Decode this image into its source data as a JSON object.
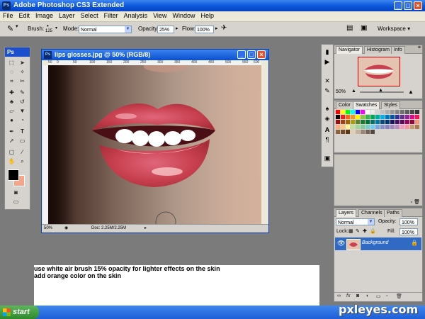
{
  "app": {
    "title": "Adobe Photoshop CS3 Extended",
    "logo": "Ps"
  },
  "menu": [
    "File",
    "Edit",
    "Image",
    "Layer",
    "Select",
    "Filter",
    "Analysis",
    "View",
    "Window",
    "Help"
  ],
  "options": {
    "brush_label": "Brush:",
    "brush_size": "125",
    "mode_label": "Mode:",
    "mode_value": "Normal",
    "opacity_label": "Opacity:",
    "opacity_value": "25%",
    "flow_label": "Flow:",
    "flow_value": "100%",
    "workspace_label": "Workspace ▾"
  },
  "toolbox": {
    "logo": "Ps"
  },
  "document": {
    "title": "lips glosses.jpg @ 50% (RGB/8)",
    "ruler_marks": [
      "50",
      "0",
      "50",
      "100",
      "150",
      "200",
      "250",
      "300",
      "350",
      "400",
      "450",
      "500",
      "550",
      "600"
    ],
    "zoom": "50%",
    "doc_info": "Doc: 2.25M/2.25M"
  },
  "navigator": {
    "tabs": [
      "Navigator",
      "Histogram",
      "Info"
    ],
    "zoom": "50%"
  },
  "color_panel": {
    "tabs": [
      "Color",
      "Swatches",
      "Styles"
    ],
    "swatches": [
      "#ff0000",
      "#ffff00",
      "#00ff00",
      "#00ffff",
      "#0000ff",
      "#ff00ff",
      "#ffffff",
      "#ebebeb",
      "#d6d6d6",
      "#c2c2c2",
      "#adadad",
      "#999999",
      "#858585",
      "#707070",
      "#5c5c5c",
      "#474747",
      "#333333",
      "#000000",
      "#ee1d24",
      "#f26522",
      "#f7941d",
      "#fff200",
      "#8dc63f",
      "#39b54a",
      "#00a651",
      "#00a99d",
      "#00aeef",
      "#0072bc",
      "#0054a6",
      "#2e3192",
      "#662d91",
      "#92278f",
      "#ec008c",
      "#ed145b",
      "#9e0b0f",
      "#a0410d",
      "#a3620a",
      "#aba000",
      "#598527",
      "#197b30",
      "#007236",
      "#00746b",
      "#0076a3",
      "#004a80",
      "#003471",
      "#1b1464",
      "#440e62",
      "#630460",
      "#9e005d",
      "#9e0039",
      "#f69679",
      "#f9ad81",
      "#fdc68a",
      "#fff799",
      "#c4df9b",
      "#a3d39c",
      "#82ca9c",
      "#7accc8",
      "#6dcff6",
      "#7da7d9",
      "#8393ca",
      "#8781bd",
      "#a187be",
      "#bd8cbf",
      "#f49ac1",
      "#f5989d",
      "#c69c6d",
      "#a67c52",
      "#8c6239",
      "#754c24",
      "#603913",
      "#e2d0b5",
      "#c7b299",
      "#998675",
      "#736357",
      "#534741"
    ]
  },
  "layers": {
    "tabs": [
      "Layers",
      "Channels",
      "Paths"
    ],
    "blend": "Normal",
    "opacity_label": "Opacity:",
    "opacity_value": "100%",
    "lock_label": "Lock:",
    "fill_label": "Fill:",
    "fill_value": "100%",
    "layer_name": "Background"
  },
  "note": {
    "line1": "use white air brush 15% opacity for lighter effects on the skin",
    "line2": "add orange color on the skin"
  },
  "taskbar": {
    "start_label": "start"
  },
  "watermark": "pxleyes.com"
}
